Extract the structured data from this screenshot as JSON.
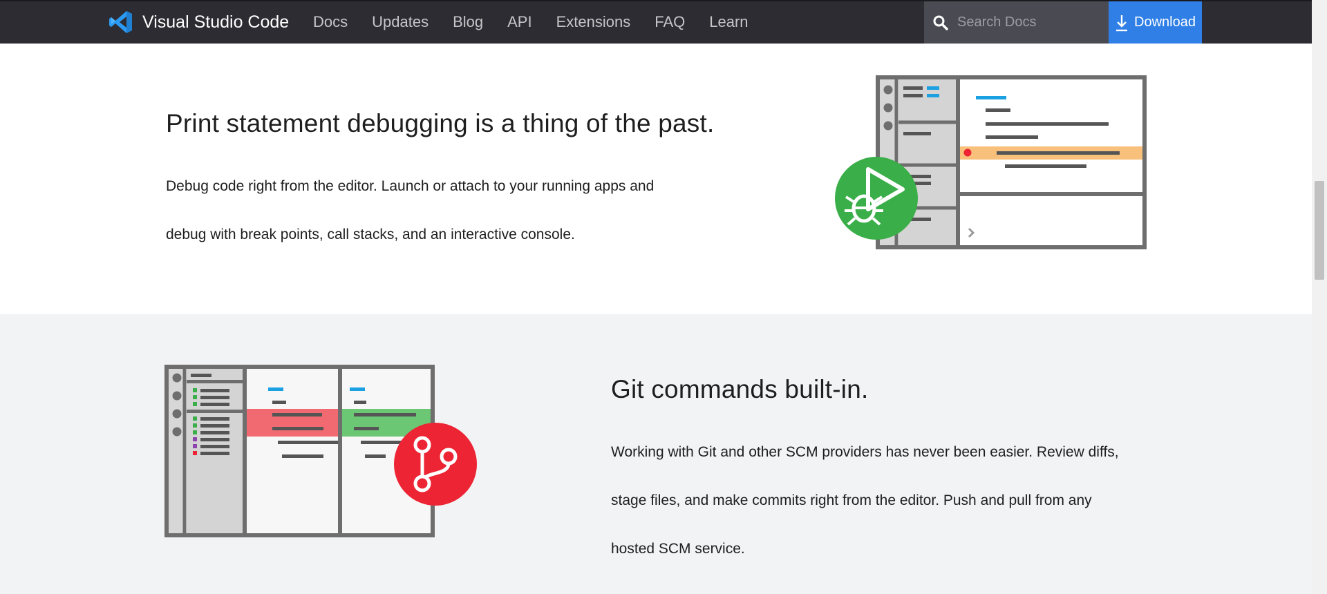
{
  "nav": {
    "brand": "Visual Studio Code",
    "links": [
      "Docs",
      "Updates",
      "Blog",
      "API",
      "Extensions",
      "FAQ",
      "Learn"
    ],
    "search_placeholder": "Search Docs",
    "download_label": "Download"
  },
  "sections": {
    "debug": {
      "title": "Print statement debugging is a thing of the past.",
      "body_line1": "Debug code right from the editor. Launch or attach to your running apps and",
      "body_line2": "debug with break points, call stacks, and an interactive console."
    },
    "git": {
      "title": "Git commands built-in.",
      "body_line1": "Working with Git and other SCM providers has never been easier. Review diffs,",
      "body_line2": "stage files, and make commits right from the editor. Push and pull from any",
      "body_line3": "hosted SCM service."
    }
  },
  "colors": {
    "nav_bg": "#2c2c32",
    "download_bg": "#2f7fe6",
    "debug_badge": "#3aae48",
    "git_badge": "#ec2434",
    "highlight_orange": "#f8c07a",
    "diff_red": "#f16a72",
    "diff_green": "#6cc774",
    "accent_blue": "#1ba1e2"
  },
  "icons": {
    "brand": "vscode-logo-icon",
    "search": "search-icon",
    "download": "download-arrow-icon",
    "debug": "play-bug-icon",
    "git": "git-branch-icon"
  }
}
